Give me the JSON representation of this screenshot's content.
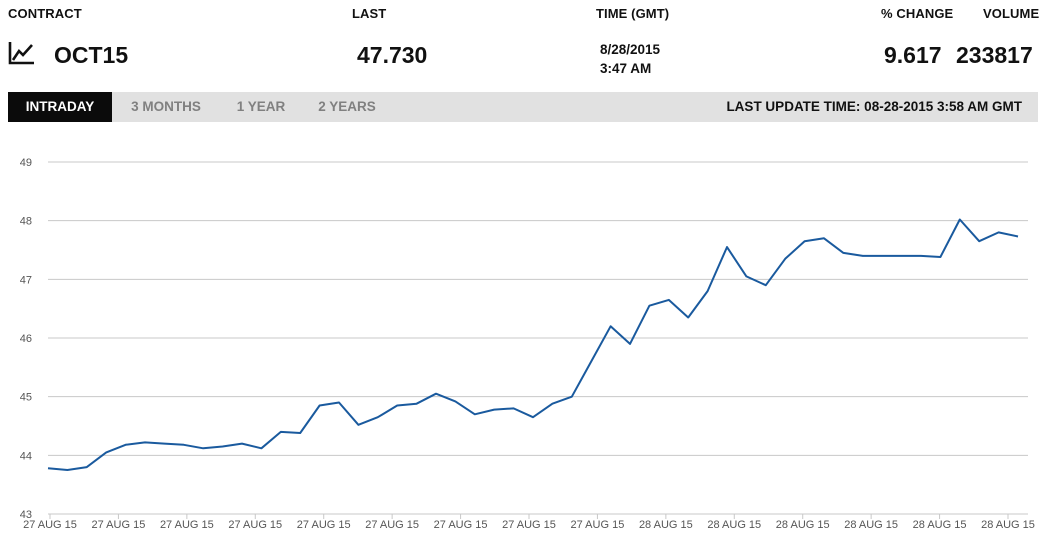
{
  "header": {
    "contract_label": "CONTRACT",
    "last_label": "LAST",
    "time_label": "TIME (GMT)",
    "change_label": "% CHANGE",
    "volume_label": "VOLUME"
  },
  "quote": {
    "contract": "OCT15",
    "last": "47.730",
    "date": "8/28/2015",
    "time": "3:47 AM",
    "change": "9.617",
    "volume": "233817"
  },
  "tabs": [
    {
      "label": "INTRADAY",
      "active": true
    },
    {
      "label": "3 MONTHS",
      "active": false
    },
    {
      "label": "1 YEAR",
      "active": false
    },
    {
      "label": "2 YEARS",
      "active": false
    }
  ],
  "last_update": "LAST UPDATE TIME: 08-28-2015 3:58 AM GMT",
  "colors": {
    "line": "#1a5a9e",
    "grid": "#c8c8c8",
    "tab_active_bg": "#0b0b0b",
    "tab_bar_bg": "#e1e1e1"
  },
  "icons": {
    "contract_icon": "line-chart-icon"
  },
  "chart_data": {
    "type": "line",
    "ylim": [
      43,
      49
    ],
    "yticks": [
      43,
      44,
      45,
      46,
      47,
      48,
      49
    ],
    "grid": true,
    "xticks": [
      "27 AUG 15",
      "27 AUG 15",
      "27 AUG 15",
      "27 AUG 15",
      "27 AUG 15",
      "27 AUG 15",
      "27 AUG 15",
      "27 AUG 15",
      "27 AUG 15",
      "28 AUG 15",
      "28 AUG 15",
      "28 AUG 15",
      "28 AUG 15",
      "28 AUG 15",
      "28 AUG 15"
    ],
    "series": [
      {
        "x": [
          0,
          2,
          4,
          6,
          8,
          10,
          12,
          14,
          16,
          18,
          20,
          22,
          24,
          26,
          28,
          30,
          32,
          34,
          36,
          38,
          40,
          42,
          44,
          46,
          48,
          50,
          52,
          54,
          56,
          58,
          60,
          62,
          64,
          66,
          68,
          70,
          72,
          74,
          76,
          78,
          80,
          82,
          84,
          86,
          88,
          90,
          92,
          94,
          96,
          98,
          100
        ],
        "values": [
          43.78,
          43.75,
          43.8,
          44.05,
          44.18,
          44.22,
          44.2,
          44.18,
          44.12,
          44.15,
          44.2,
          44.12,
          44.4,
          44.38,
          44.85,
          44.9,
          44.52,
          44.65,
          44.85,
          44.88,
          45.05,
          44.92,
          44.7,
          44.78,
          44.8,
          44.65,
          44.88,
          45.0,
          45.6,
          46.2,
          45.9,
          46.55,
          46.65,
          46.35,
          46.8,
          47.55,
          47.05,
          46.9,
          47.35,
          47.65,
          47.7,
          47.45,
          47.4,
          47.4,
          47.4,
          47.4,
          47.38,
          48.02,
          47.65,
          47.8,
          47.73
        ]
      }
    ]
  }
}
